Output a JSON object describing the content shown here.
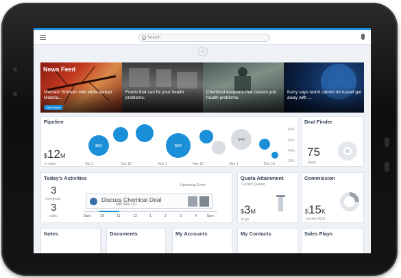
{
  "topbar": {
    "search_placeholder": "Search"
  },
  "news": {
    "title": "News Feed",
    "button_label": "More News",
    "items": [
      {
        "caption": "Vietnam Stricken with wide-spread Malaria..."
      },
      {
        "caption": "Foods that can fix your health problems."
      },
      {
        "caption": "Chemical weapons that causes you health problems."
      },
      {
        "caption": "Kerry says world cannot let Assad get away with ..."
      }
    ]
  },
  "pipeline": {
    "title": "Pipeline",
    "amount_prefix": "$",
    "amount": "12",
    "amount_unit": "M",
    "sub_label": "in value",
    "bubbles": [
      {
        "label": "$6M"
      },
      {
        "label": ""
      },
      {
        "label": ""
      },
      {
        "label": "$8M"
      },
      {
        "label": ""
      },
      {
        "label": ""
      },
      {
        "label": "$4M"
      },
      {
        "label": ""
      },
      {
        "label": ""
      }
    ],
    "x_ticks": [
      "Oct 1",
      "Oct 15",
      "Nov 1",
      "Nov 15",
      "Dec 1",
      "Dec 15"
    ],
    "y_ticks": [
      "80%",
      "60%",
      "40%",
      "20%"
    ],
    "colors": {
      "primary": "#1b8fd8",
      "secondary": "#d9dde2"
    }
  },
  "deal_finder": {
    "title": "Deal Finder",
    "count": "75",
    "sub_label": "leads"
  },
  "activities": {
    "title": "Today's Activities",
    "meetings_count": "3",
    "meetings_label": "meetings",
    "calls_count": "3",
    "calls_label": "calls",
    "upcoming_label": "Upcoming Event",
    "event_title": "Discuss Chemical Deal",
    "event_subtitle": "with Rike LLC",
    "time_ticks": [
      "9am",
      "10",
      "11",
      "12",
      "1",
      "2",
      "3",
      "4",
      "5pm"
    ]
  },
  "quota": {
    "title": "Quota Attainment",
    "sub_label": "Current Quarter",
    "amount_prefix": "$",
    "amount": "3",
    "amount_unit": "M",
    "foot_label": "to go"
  },
  "commission": {
    "title": "Commission",
    "amount_prefix": "$",
    "amount": "15",
    "amount_unit": "K",
    "foot_label": "earned 2013"
  },
  "bottom_cards": {
    "notes": "Notes",
    "documents": "Documents",
    "accounts": "My Accounts",
    "contacts": "My Contacts",
    "sales_plays": "Sales Plays"
  }
}
